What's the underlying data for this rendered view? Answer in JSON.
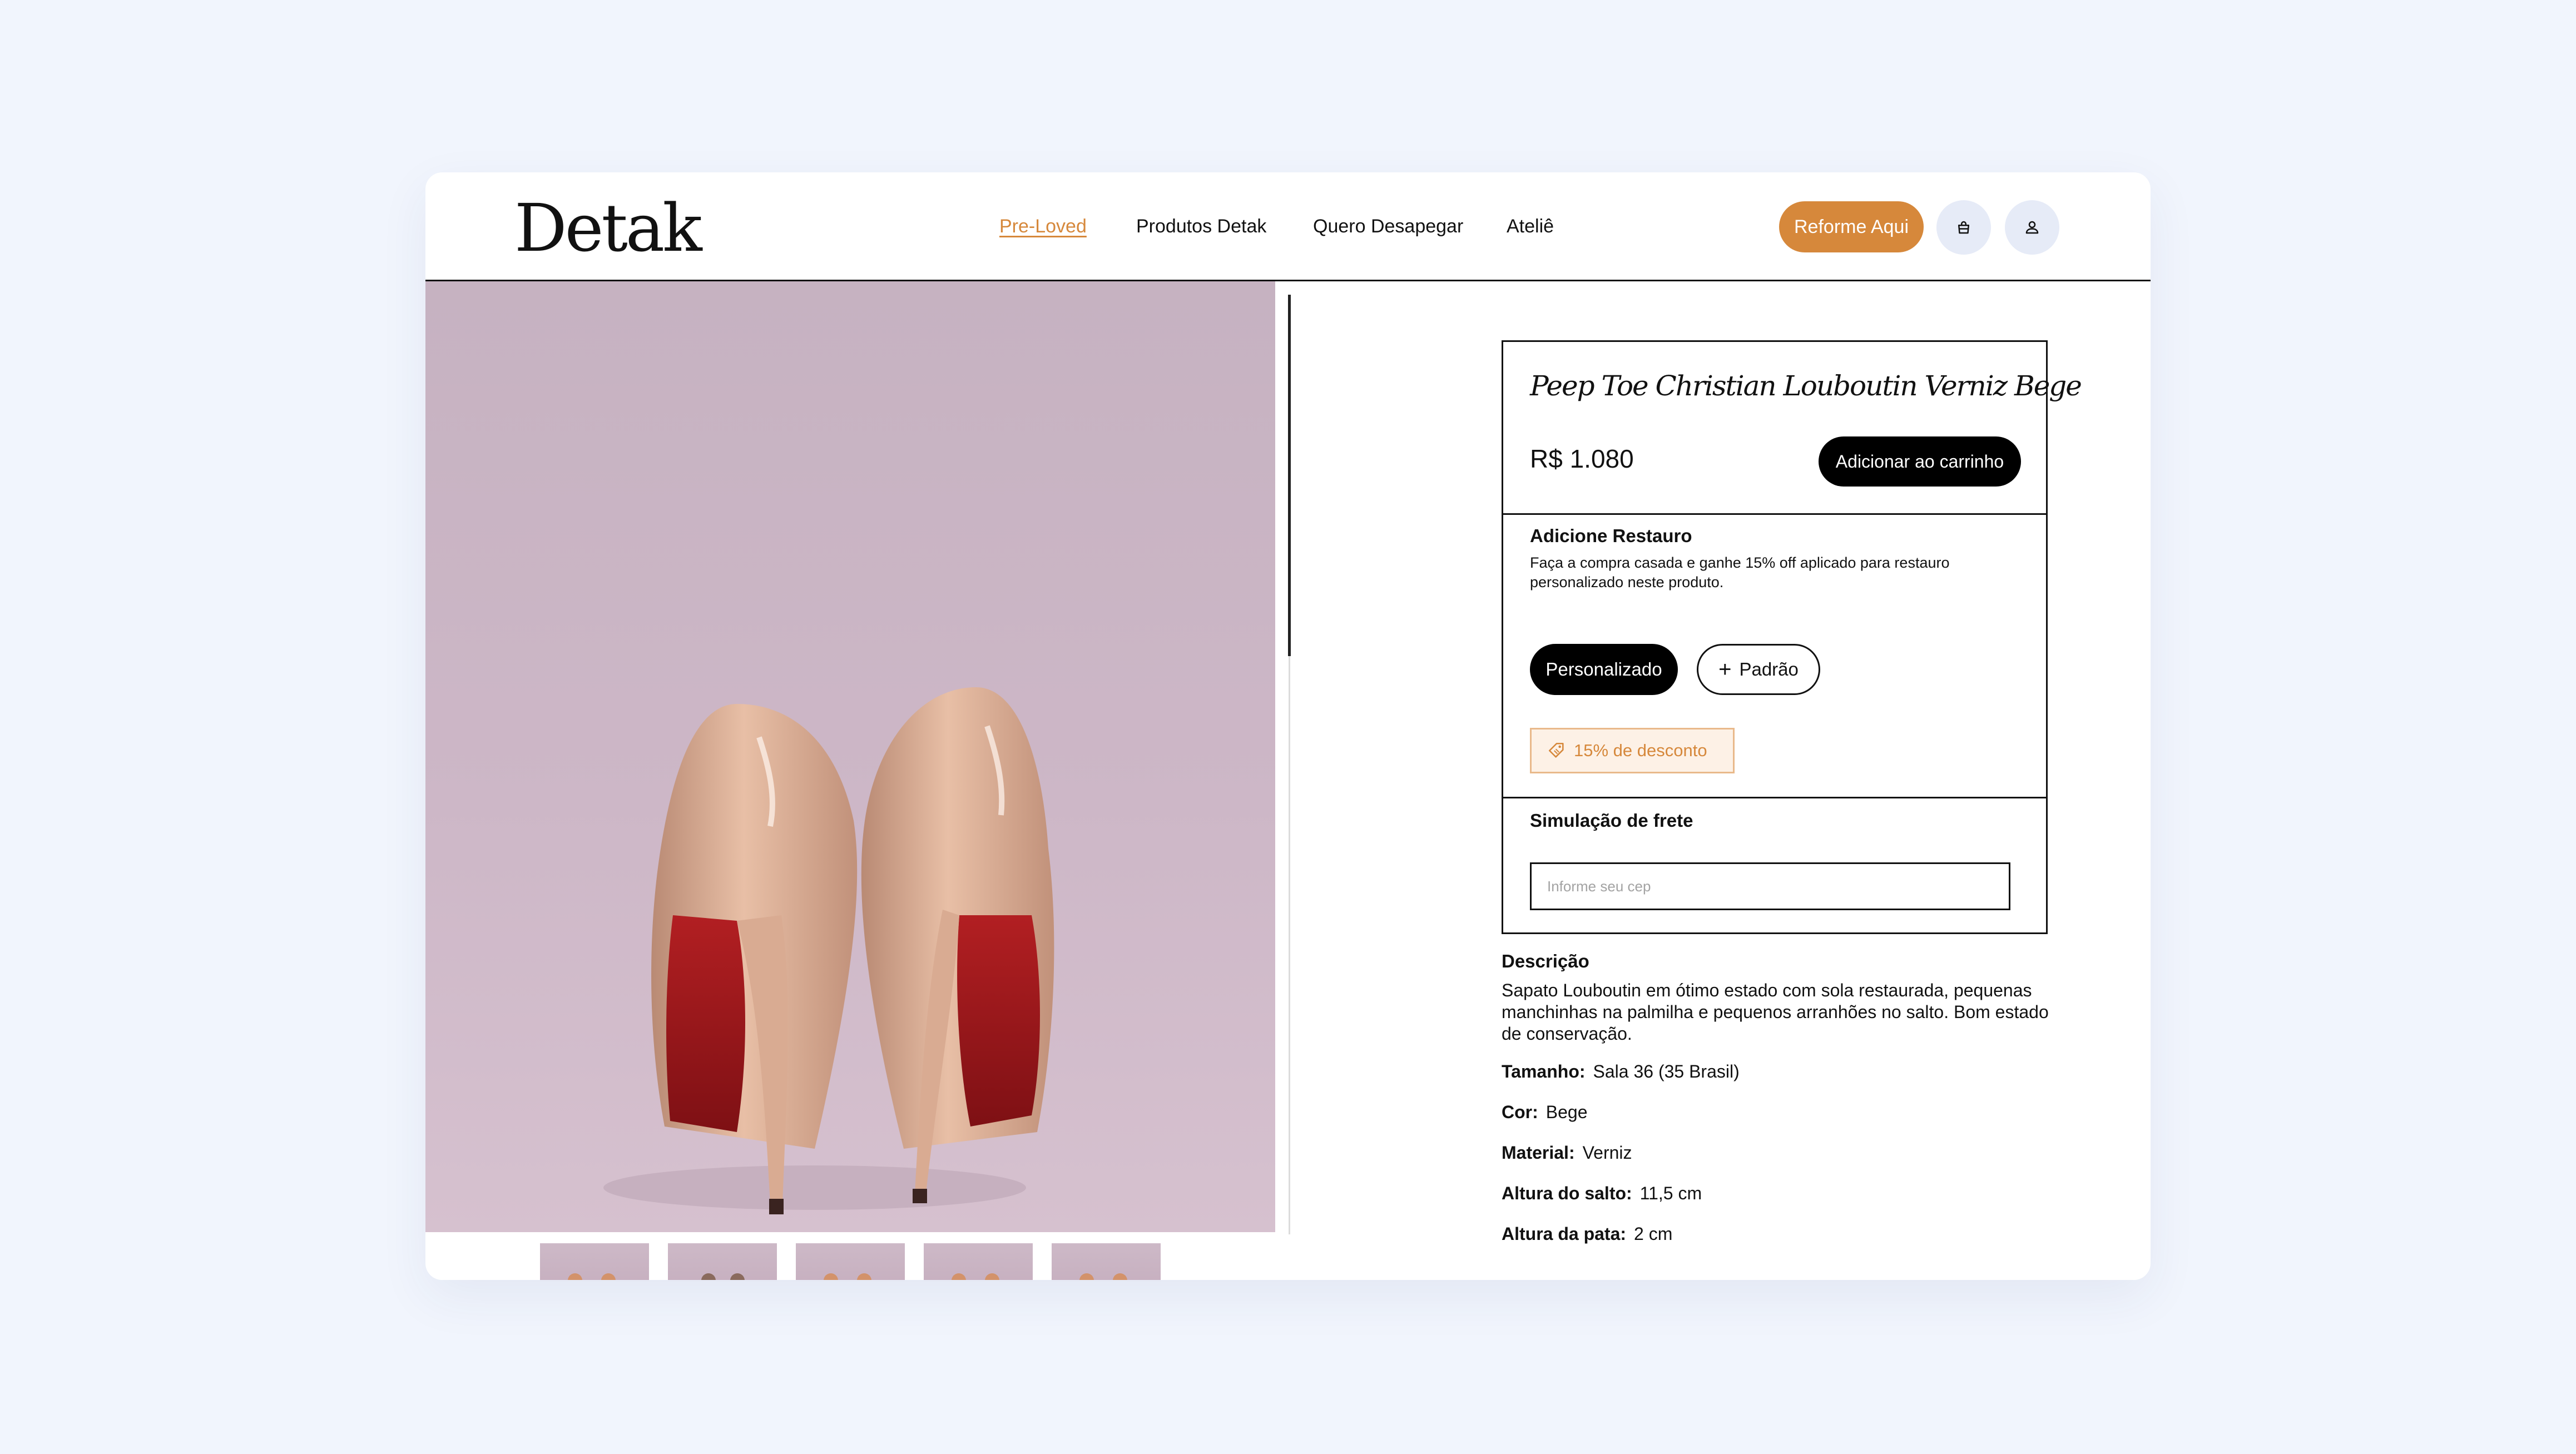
{
  "brand": {
    "logo": "Detak"
  },
  "nav": {
    "items": [
      {
        "label": "Pre-Loved",
        "active": true
      },
      {
        "label": "Produtos Detak",
        "active": false
      },
      {
        "label": "Quero Desapegar",
        "active": false
      },
      {
        "label": "Ateliê",
        "active": false
      }
    ],
    "cta_label": "Reforme Aqui"
  },
  "icons": {
    "bag": "shopping-bag-icon",
    "user": "user-icon",
    "tag": "tag-icon",
    "plus": "plus-icon"
  },
  "colors": {
    "accent": "#d6883b",
    "dark": "#000000",
    "background": "#f1f5fd"
  },
  "product": {
    "title": "Peep Toe Christian Louboutin Verniz Bege",
    "price": "R$ 1.080",
    "add_to_cart_label": "Adicionar ao carrinho"
  },
  "restauro": {
    "heading": "Adicione Restauro",
    "text": "Faça a compra casada e ganhe 15% off aplicado para restauro personalizado neste produto.",
    "option_custom": "Personalizado",
    "option_standard": "Padrão",
    "discount_label": "15% de desconto"
  },
  "frete": {
    "heading": "Simulação de frete",
    "placeholder": "Informe seu cep"
  },
  "description": {
    "heading": "Descrição",
    "text": "Sapato Louboutin em ótimo estado com sola restaurada, pequenas manchinhas na palmilha e pequenos arranhões no salto. Bom estado de conservação.",
    "specs": [
      {
        "label": "Tamanho:",
        "value": "Sala 36 (35 Brasil)"
      },
      {
        "label": "Cor:",
        "value": "Bege"
      },
      {
        "label": "Material:",
        "value": "Verniz"
      },
      {
        "label": "Altura do salto:",
        "value": "11,5 cm"
      },
      {
        "label": "Altura da pata:",
        "value": "2 cm"
      }
    ]
  }
}
